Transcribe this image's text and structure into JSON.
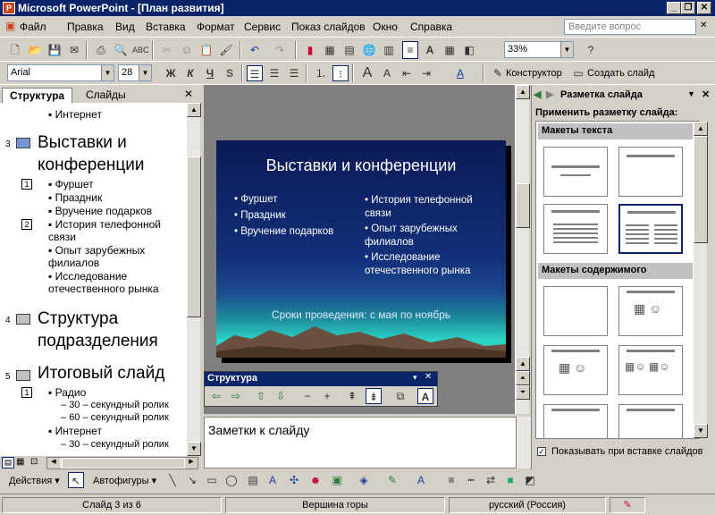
{
  "window": {
    "title": "Microsoft PowerPoint - [План развития]",
    "min": "_",
    "restore": "❐",
    "close": "✕"
  },
  "menu": {
    "items": [
      "Файл",
      "Правка",
      "Вид",
      "Вставка",
      "Формат",
      "Сервис",
      "Показ слайдов",
      "Окно",
      "Справка"
    ],
    "help_placeholder": "Введите вопрос"
  },
  "standard_toolbar": {
    "zoom": "33%"
  },
  "format_toolbar": {
    "font": "Arial",
    "size": "28",
    "bold": "Ж",
    "italic": "К",
    "underline": "Ч",
    "shadow": "S",
    "designer": "Конструктор",
    "new_slide": "Создать слайд"
  },
  "left_pane": {
    "tabs": [
      "Структура",
      "Слайды"
    ],
    "close": "✕",
    "outline": [
      {
        "kind": "bullet",
        "text": "Интернет"
      },
      {
        "kind": "slide",
        "num": "3",
        "title": "Выставки и конференции"
      },
      {
        "kind": "bullet",
        "text": "Фуршет"
      },
      {
        "kind": "bullet",
        "text": "Праздник"
      },
      {
        "kind": "bullet",
        "text": "Вручение подарков"
      },
      {
        "kind": "bullet",
        "text": "История телефонной связи"
      },
      {
        "kind": "bullet",
        "text": "Опыт зарубежных филиалов"
      },
      {
        "kind": "bullet",
        "text": "Исследование отечественного рынка"
      },
      {
        "kind": "slide",
        "num": "4",
        "title": "Структура подразделения"
      },
      {
        "kind": "slide",
        "num": "5",
        "title": "Итоговый слайд"
      },
      {
        "kind": "bullet",
        "text": "Радио"
      },
      {
        "kind": "sub",
        "text": "30 – секундный ролик"
      },
      {
        "kind": "sub",
        "text": "60 – секундный ролик"
      },
      {
        "kind": "bullet",
        "text": "Интернет"
      },
      {
        "kind": "sub",
        "text": "30 – секундный ролик"
      }
    ],
    "col_markers": [
      "1",
      "2",
      "1"
    ]
  },
  "slide": {
    "title": "Выставки и конференции",
    "left_bullets": [
      "Фуршет",
      "Праздник",
      "Вручение подарков"
    ],
    "right_bullets": [
      "История телефонной связи",
      "Опыт зарубежных филиалов",
      "Исследование отечественного рынка"
    ],
    "footer": "Сроки проведения: с мая по ноябрь"
  },
  "notes": {
    "text": "Заметки к слайду"
  },
  "outline_toolbar": {
    "title": "Структура"
  },
  "task_pane": {
    "title": "Разметка слайда",
    "apply_label": "Применить разметку слайда:",
    "section_text": "Макеты текста",
    "section_content": "Макеты содержимого",
    "show_on_insert": "Показывать при вставке слайдов"
  },
  "drawing_toolbar": {
    "actions": "Действия",
    "autoshapes": "Автофигуры"
  },
  "status": {
    "slide": "Слайд 3 из 6",
    "design": "Вершина горы",
    "lang": "русский (Россия)"
  },
  "colors": {
    "titlebar": "#0a246a",
    "face": "#d4d0c8",
    "slide_top": "#0b1a56",
    "slide_glow": "#2cd4c6"
  }
}
